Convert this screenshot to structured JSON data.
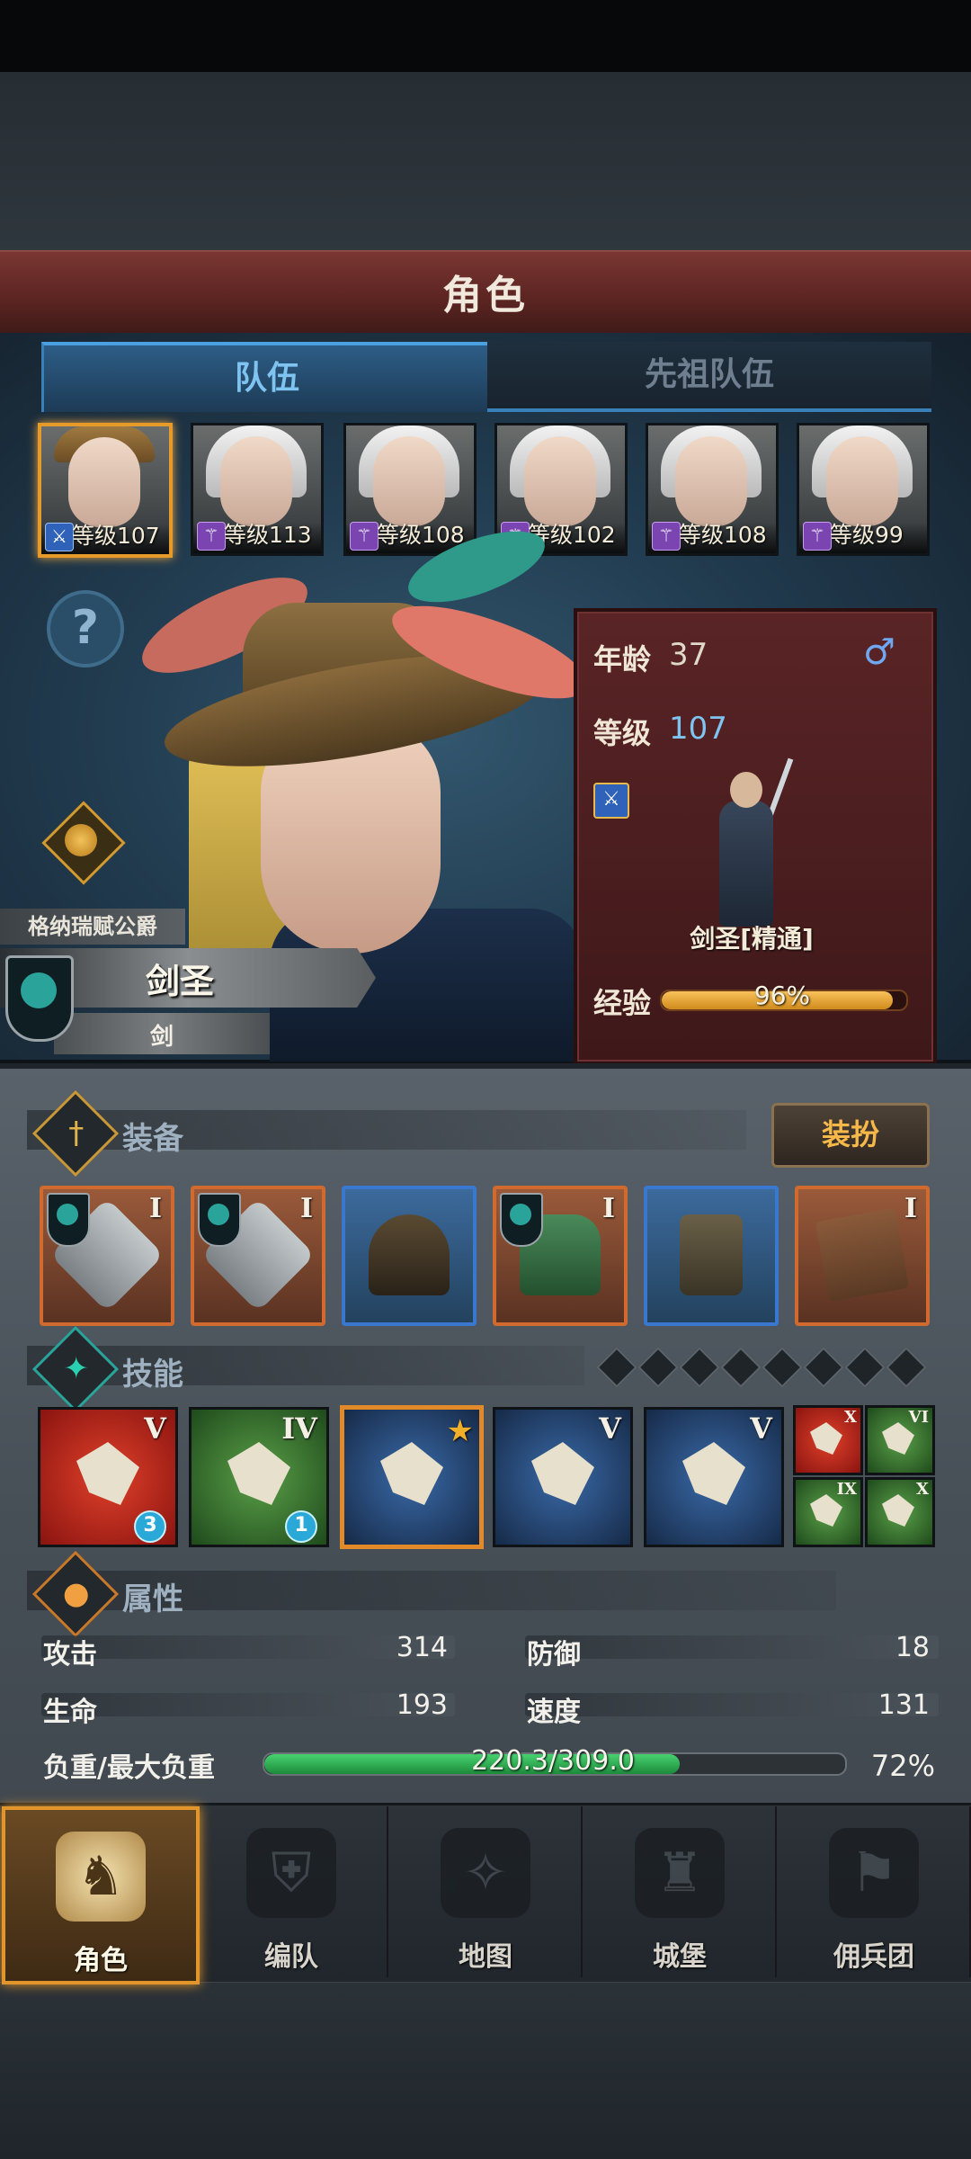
{
  "header": {
    "title": "角色"
  },
  "tabs": [
    {
      "label": "队伍",
      "active": true
    },
    {
      "label": "先祖队伍",
      "active": false
    }
  ],
  "party": [
    {
      "level": "等级107",
      "class_color": "blue",
      "selected": true,
      "hair": "hat"
    },
    {
      "level": "等级113",
      "class_color": "purple",
      "selected": false,
      "hair": "elf"
    },
    {
      "level": "等级108",
      "class_color": "purple",
      "selected": false,
      "hair": "elf"
    },
    {
      "level": "等级102",
      "class_color": "purple",
      "selected": false,
      "hair": "elf"
    },
    {
      "level": "等级108",
      "class_color": "purple",
      "selected": false,
      "hair": "elf"
    },
    {
      "level": "等级99",
      "class_color": "purple",
      "selected": false,
      "hair": "elf"
    }
  ],
  "character": {
    "title_plate": "格纳瑞赋公爵",
    "class_plate": "剑圣",
    "weapon_plate": "剑",
    "age_label": "年龄",
    "age": "37",
    "gender_icon": "male-icon",
    "gender_symbol": "♂",
    "level_label": "等级",
    "level": "107",
    "class_name": "剑圣[精通]",
    "exp_label": "经验",
    "exp_text": "96%",
    "exp_fraction": 0.96
  },
  "equipment": {
    "title": "装备",
    "outfit_button": "装扮",
    "slots": [
      {
        "kind": "weapon",
        "tier": "I",
        "rarity": "orange",
        "emblem": true
      },
      {
        "kind": "weapon",
        "tier": "I",
        "rarity": "orange",
        "emblem": true
      },
      {
        "kind": "hood",
        "tier": "",
        "rarity": "blue",
        "emblem": false
      },
      {
        "kind": "armor",
        "tier": "I",
        "rarity": "orange",
        "emblem": true
      },
      {
        "kind": "boots",
        "tier": "",
        "rarity": "blue",
        "emblem": false
      },
      {
        "kind": "book",
        "tier": "I",
        "rarity": "orange",
        "emblem": false
      }
    ]
  },
  "skills": {
    "title": "技能",
    "dots": 8,
    "main": [
      {
        "color": "red",
        "tier": "V",
        "count": "3"
      },
      {
        "color": "green",
        "tier": "IV",
        "count": "1"
      },
      {
        "color": "blue",
        "tier": "",
        "star": "★",
        "selected": true
      },
      {
        "color": "blue",
        "tier": "V"
      },
      {
        "color": "blue",
        "tier": "V"
      }
    ],
    "mini": [
      {
        "color": "red",
        "tier": "X"
      },
      {
        "color": "green",
        "tier": "VI"
      },
      {
        "color": "green",
        "tier": "IX"
      },
      {
        "color": "green",
        "tier": "X"
      }
    ]
  },
  "attributes": {
    "title": "属性",
    "attack_label": "攻击",
    "attack": "314",
    "defense_label": "防御",
    "defense": "18",
    "hp_label": "生命",
    "hp": "193",
    "speed_label": "速度",
    "speed": "131",
    "load_label": "负重/最大负重",
    "load_text": "220.3/309.0",
    "load_pct": "72%",
    "load_fraction": 0.72
  },
  "nav": [
    {
      "label": "角色",
      "active": true,
      "icon": "knight-icon",
      "glyph": "♞"
    },
    {
      "label": "编队",
      "active": false,
      "icon": "helmet-icon",
      "glyph": "⛨"
    },
    {
      "label": "地图",
      "active": false,
      "icon": "compass-map-icon",
      "glyph": "✧"
    },
    {
      "label": "城堡",
      "active": false,
      "icon": "castle-icon",
      "glyph": "♜"
    },
    {
      "label": "佣兵团",
      "active": false,
      "icon": "mercenary-icon",
      "glyph": "⚑"
    }
  ],
  "colors": {
    "accent_orange": "#e2952a",
    "tab_active": "#7fc4f0",
    "exp_bar": "#f8c25a",
    "load_bar": "#48d270"
  }
}
